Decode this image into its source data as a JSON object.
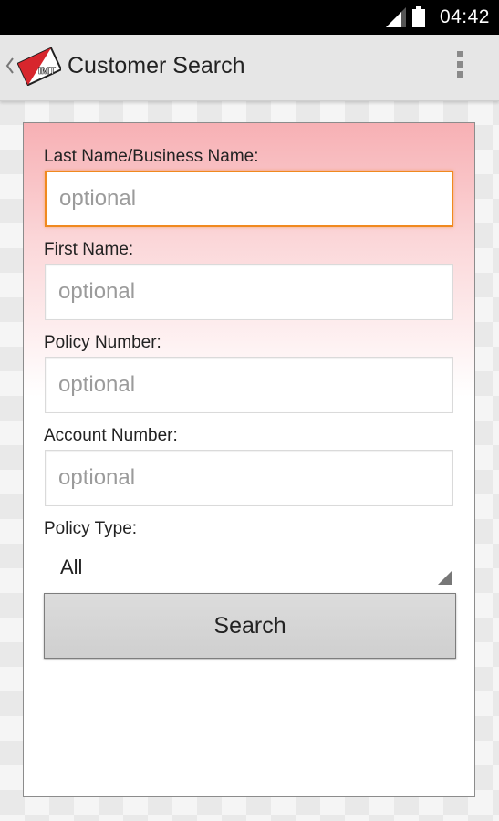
{
  "status_bar": {
    "time": "04:42"
  },
  "action_bar": {
    "title": "Customer Search",
    "logo_text": "IMT"
  },
  "form": {
    "last_name": {
      "label": "Last Name/Business Name:",
      "placeholder": "optional",
      "value": ""
    },
    "first_name": {
      "label": "First Name:",
      "placeholder": "optional",
      "value": ""
    },
    "policy_number": {
      "label": "Policy Number:",
      "placeholder": "optional",
      "value": ""
    },
    "account_number": {
      "label": "Account Number:",
      "placeholder": "optional",
      "value": ""
    },
    "policy_type": {
      "label": "Policy Type:",
      "selected": "All"
    },
    "search_label": "Search"
  },
  "colors": {
    "focus_border": "#f0891f",
    "card_gradient_top": "#f7b0b4",
    "logo_red": "#d7262d"
  },
  "icons": [
    "signal-icon",
    "battery-icon",
    "up-caret-icon",
    "app-logo-icon",
    "overflow-menu-icon",
    "dropdown-arrow-icon"
  ]
}
